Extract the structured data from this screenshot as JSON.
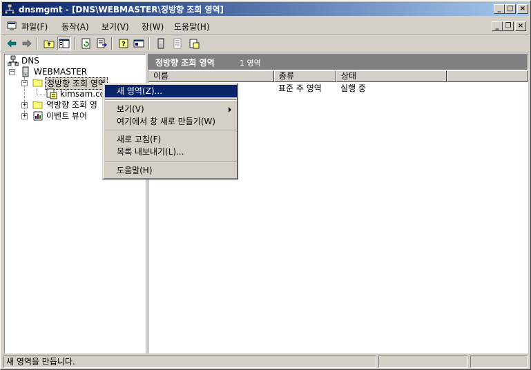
{
  "window": {
    "title": "dnsmgmt - [DNS\\WEBMASTER\\정방향 조회 영역]",
    "accent": "#0a246a"
  },
  "menu": {
    "items": [
      {
        "label": "파일(F)"
      },
      {
        "label": "동작(A)"
      },
      {
        "label": "보기(V)"
      },
      {
        "label": "창(W)"
      },
      {
        "label": "도움말(H)"
      }
    ]
  },
  "toolbar": {
    "buttons": [
      "back-arrow-icon",
      "forward-arrow-icon",
      "up-folder-icon",
      "show-hide-tree-icon",
      "refresh-icon",
      "export-list-icon",
      "help-icon",
      "properties-icon",
      "server-icon",
      "document-icon",
      "zone-icon"
    ]
  },
  "tree": {
    "root": "DNS",
    "server": "WEBMASTER",
    "forward_zones": "정방향 조회 영역",
    "zone": "kimsam.co",
    "reverse_zones": "역방향 조회 영",
    "event_viewer": "이벤트 뷰어"
  },
  "pane": {
    "title": "정방향 조회 영역",
    "count": "1 영역",
    "columns": [
      "이름",
      "종류",
      "상태"
    ],
    "rows": [
      {
        "type": "표준 주 영역",
        "status": "실행 중"
      }
    ]
  },
  "context_menu": {
    "new_zone": "새 영역(Z)...",
    "view": "보기(V)",
    "new_window": "여기에서 창 새로 만들기(W)",
    "refresh": "새로 고침(F)",
    "export": "목록 내보내기(L)...",
    "help": "도움말(H)"
  },
  "status": {
    "text": "새 영역을 만듭니다."
  }
}
